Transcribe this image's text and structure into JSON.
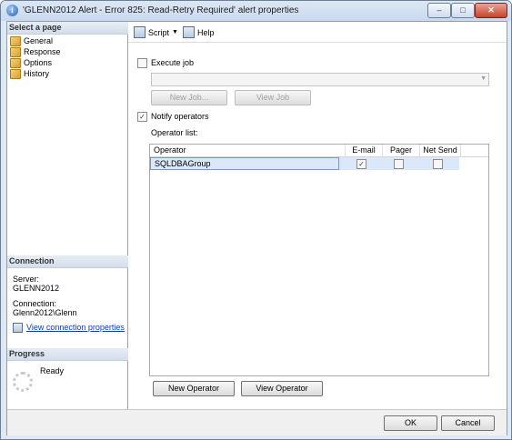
{
  "window": {
    "title": "'GLENN2012 Alert - Error 825: Read-Retry Required' alert properties",
    "minimize_glyph": "–",
    "maximize_glyph": "□",
    "close_glyph": "✕"
  },
  "left": {
    "select_page_header": "Select a page",
    "pages": [
      {
        "label": "General"
      },
      {
        "label": "Response"
      },
      {
        "label": "Options"
      },
      {
        "label": "History"
      }
    ],
    "connection_header": "Connection",
    "server_label": "Server:",
    "server_value": "GLENN2012",
    "connection_label": "Connection:",
    "connection_value": "Glenn2012\\Glenn",
    "view_connection_link": "View connection properties",
    "progress_header": "Progress",
    "progress_status": "Ready"
  },
  "toolbar": {
    "script_label": "Script",
    "help_label": "Help"
  },
  "response": {
    "execute_job_label": "Execute job",
    "execute_job_checked": false,
    "job_combo_value": "",
    "new_job_label": "New Job...",
    "view_job_label": "View Job",
    "notify_operators_label": "Notify operators",
    "notify_operators_checked": true,
    "operator_list_label": "Operator list:",
    "columns": [
      "Operator",
      "E-mail",
      "Pager",
      "Net Send"
    ],
    "rows": [
      {
        "operator": "SQLDBAGroup",
        "email": true,
        "pager": false,
        "net_send": false
      }
    ],
    "new_operator_label": "New Operator",
    "view_operator_label": "View Operator"
  },
  "footer": {
    "ok_label": "OK",
    "cancel_label": "Cancel"
  },
  "colors": {
    "link": "#0d3fa6",
    "selected_row": "#dbe8f9",
    "window_frame": "#dfe9f5"
  }
}
